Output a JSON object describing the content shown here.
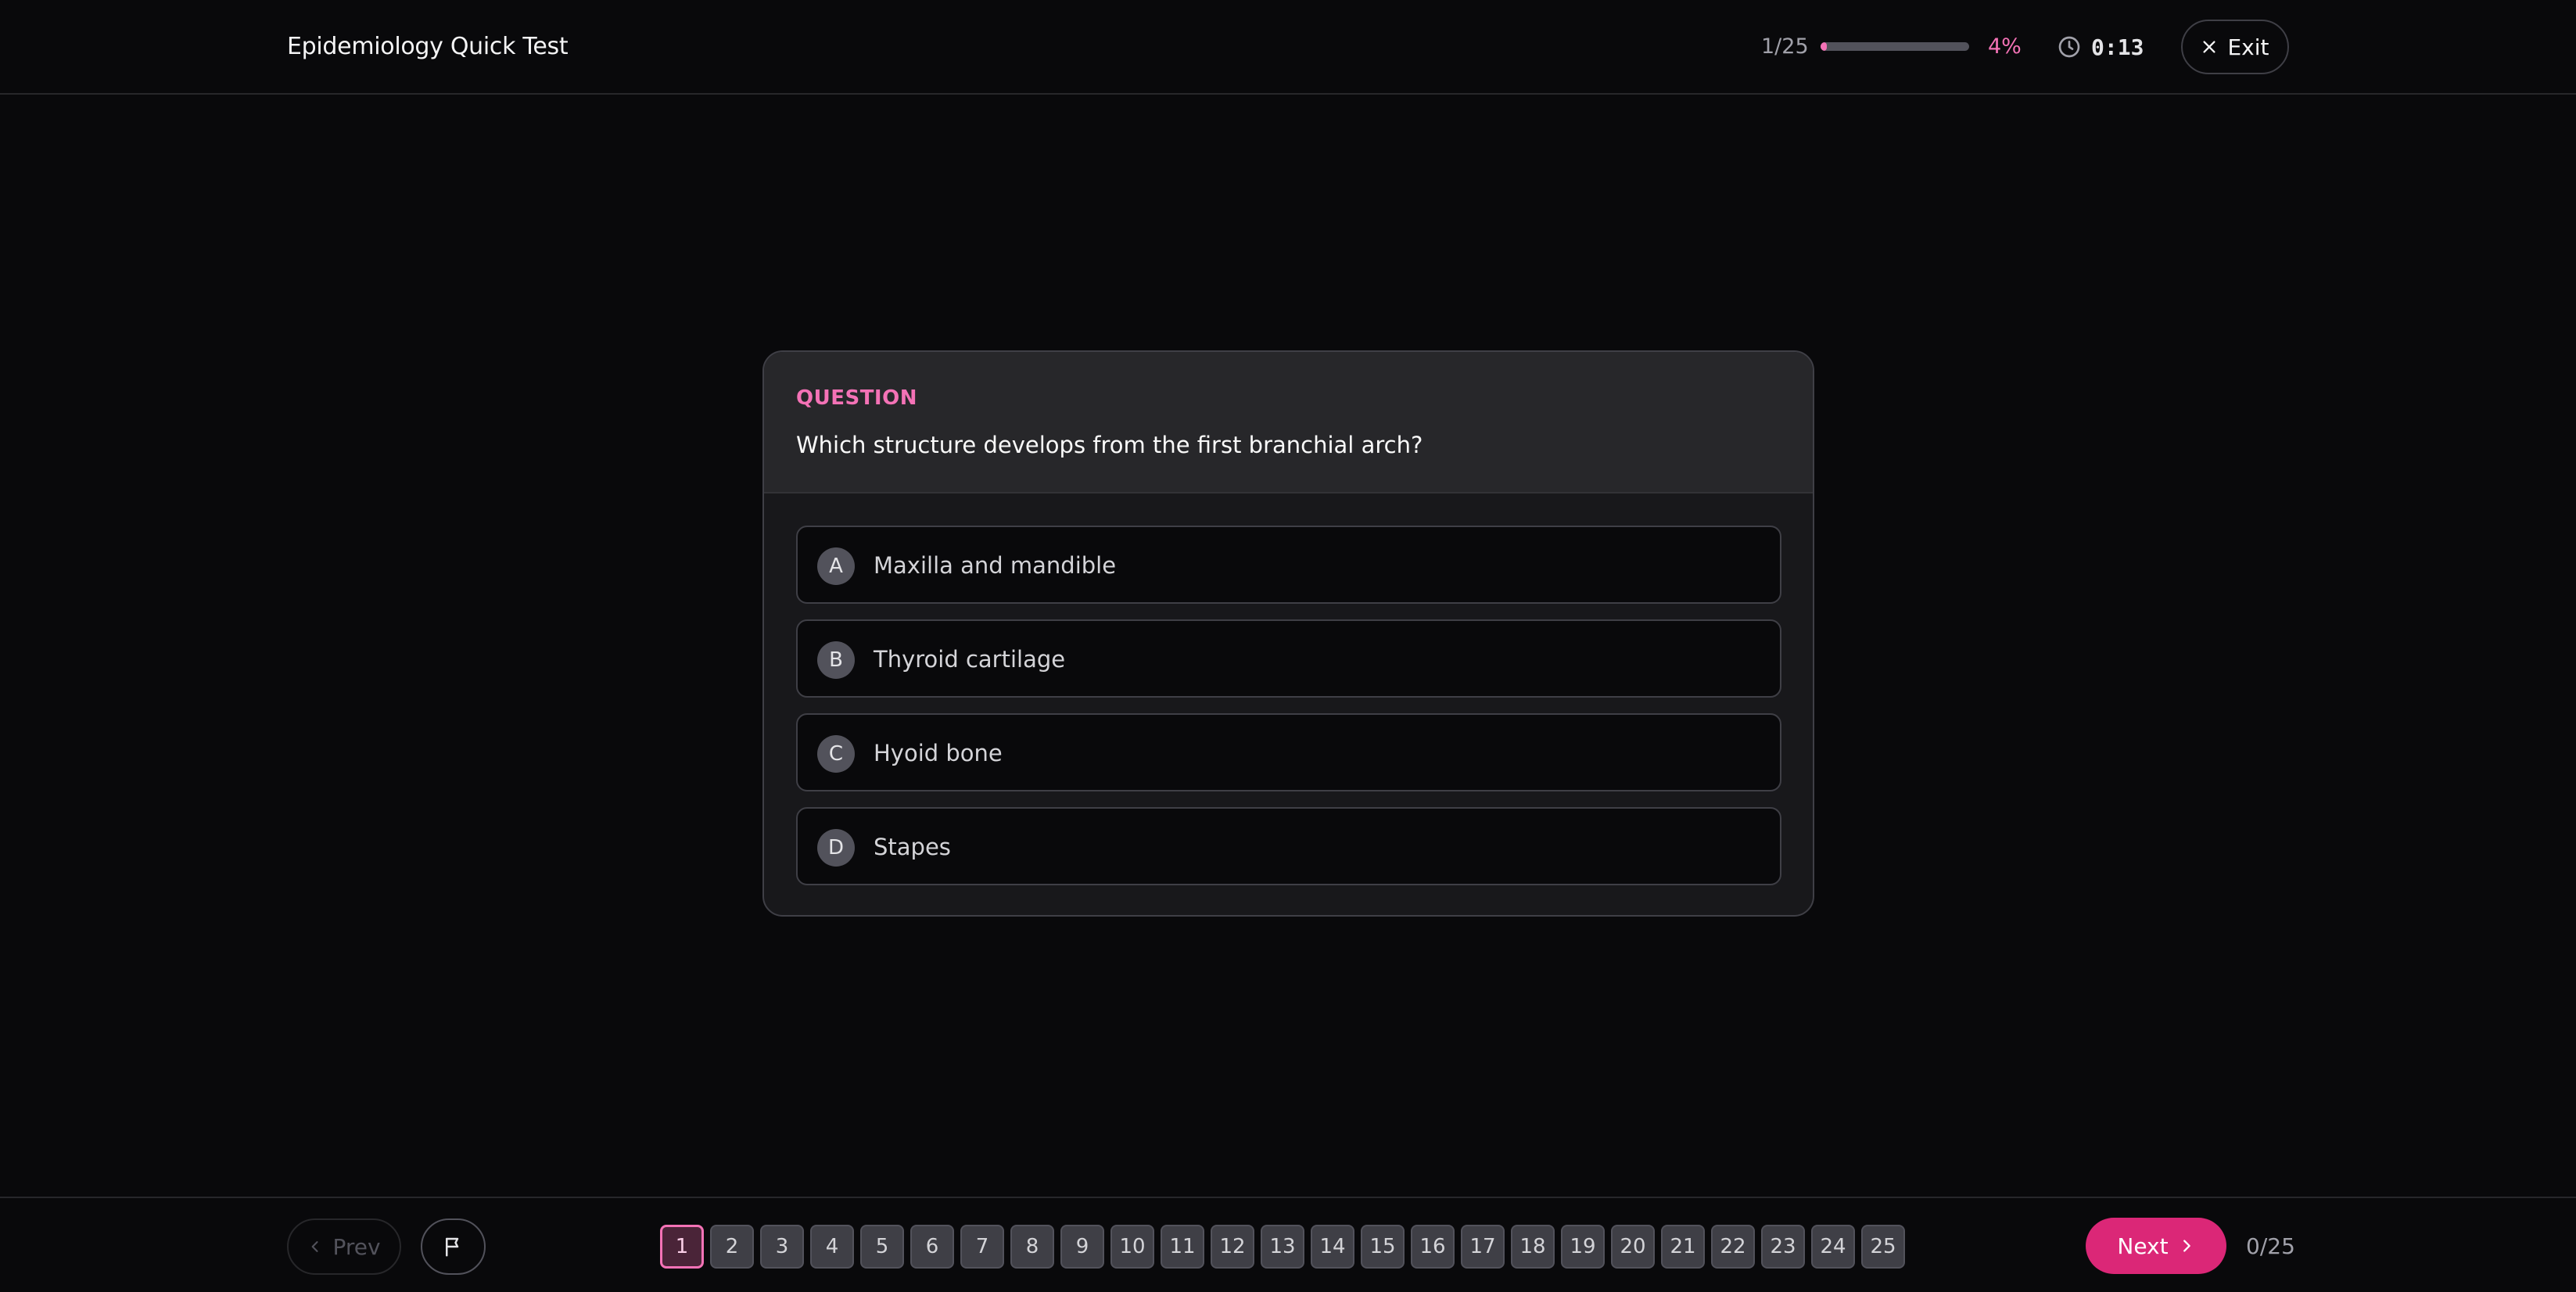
{
  "header": {
    "title": "Epidemiology Quick Test",
    "counter": "1/25",
    "progress": 0.04,
    "progress_label": "4%",
    "timer": "0:13",
    "exit_label": "Exit"
  },
  "question": {
    "label": "QUESTION",
    "text": "Which structure develops from the first branchial arch?",
    "options": [
      {
        "letter": "A",
        "text": "Maxilla and mandible"
      },
      {
        "letter": "B",
        "text": "Thyroid cartilage"
      },
      {
        "letter": "C",
        "text": "Hyoid bone"
      },
      {
        "letter": "D",
        "text": "Stapes"
      }
    ]
  },
  "footer": {
    "prev_label": "Prev",
    "pages": [
      "1",
      "2",
      "3",
      "4",
      "5",
      "6",
      "7",
      "8",
      "9",
      "10",
      "11",
      "12",
      "13",
      "14",
      "15",
      "16",
      "17",
      "18",
      "19",
      "20",
      "21",
      "22",
      "23",
      "24",
      "25"
    ],
    "current_page": 1,
    "next_label": "Next",
    "answered": "0/25"
  },
  "colors": {
    "accent": "#f472b6",
    "primary_button": "#db2777",
    "background": "#09090b"
  },
  "icons": [
    "clock-icon",
    "close-icon",
    "chevron-left-icon",
    "flag-icon",
    "chevron-right-icon"
  ]
}
